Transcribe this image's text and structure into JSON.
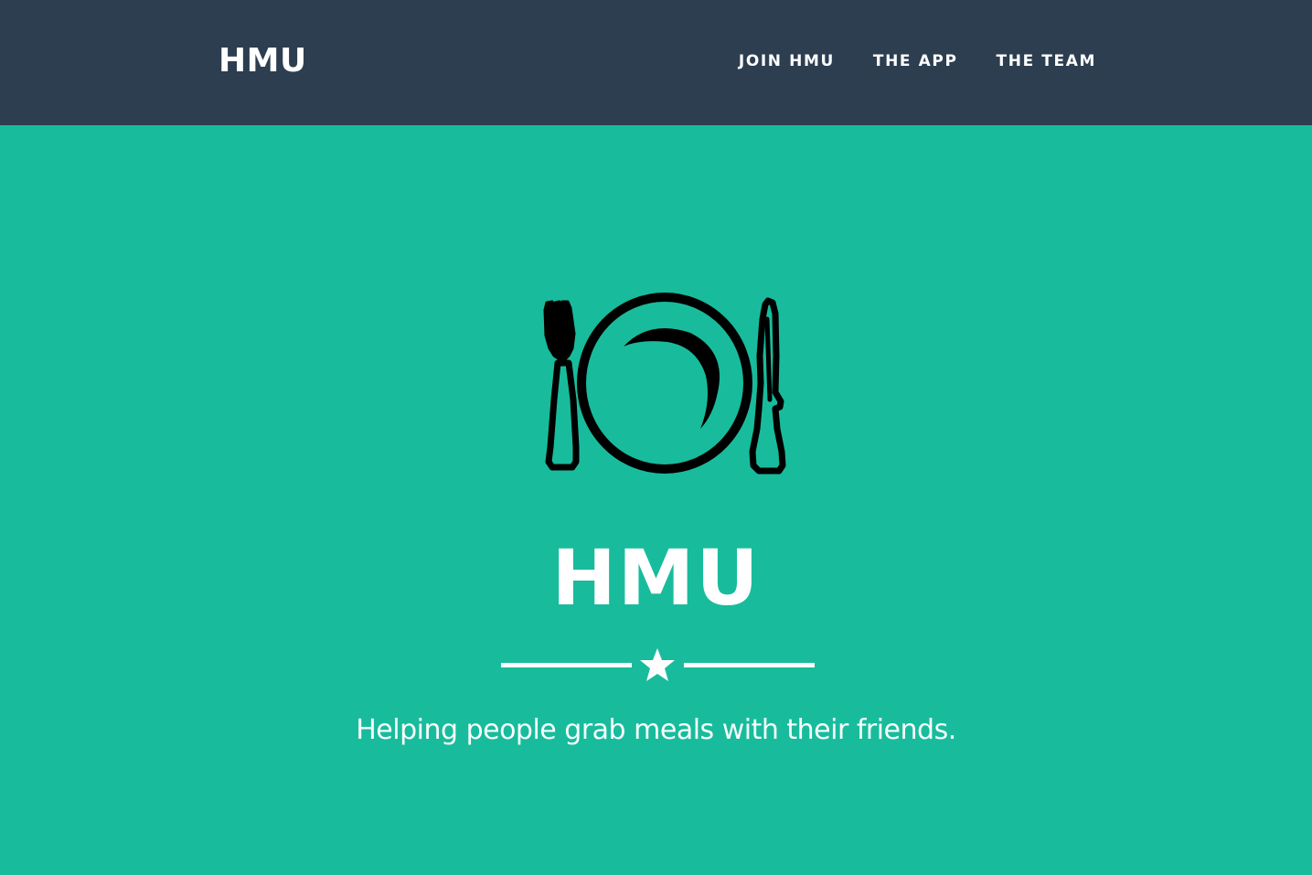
{
  "navbar": {
    "brand": "HMU",
    "links": [
      {
        "label": "JOIN HMU"
      },
      {
        "label": "THE APP"
      },
      {
        "label": "THE TEAM"
      }
    ]
  },
  "hero": {
    "icon": "plate-fork-knife-icon",
    "title": "HMU",
    "divider_icon": "star-icon",
    "tagline": "Helping people grab meals with their friends."
  },
  "colors": {
    "navbar_bg": "#2c3e50",
    "hero_bg": "#18bc9c",
    "text": "#ffffff",
    "icon": "#000000"
  }
}
